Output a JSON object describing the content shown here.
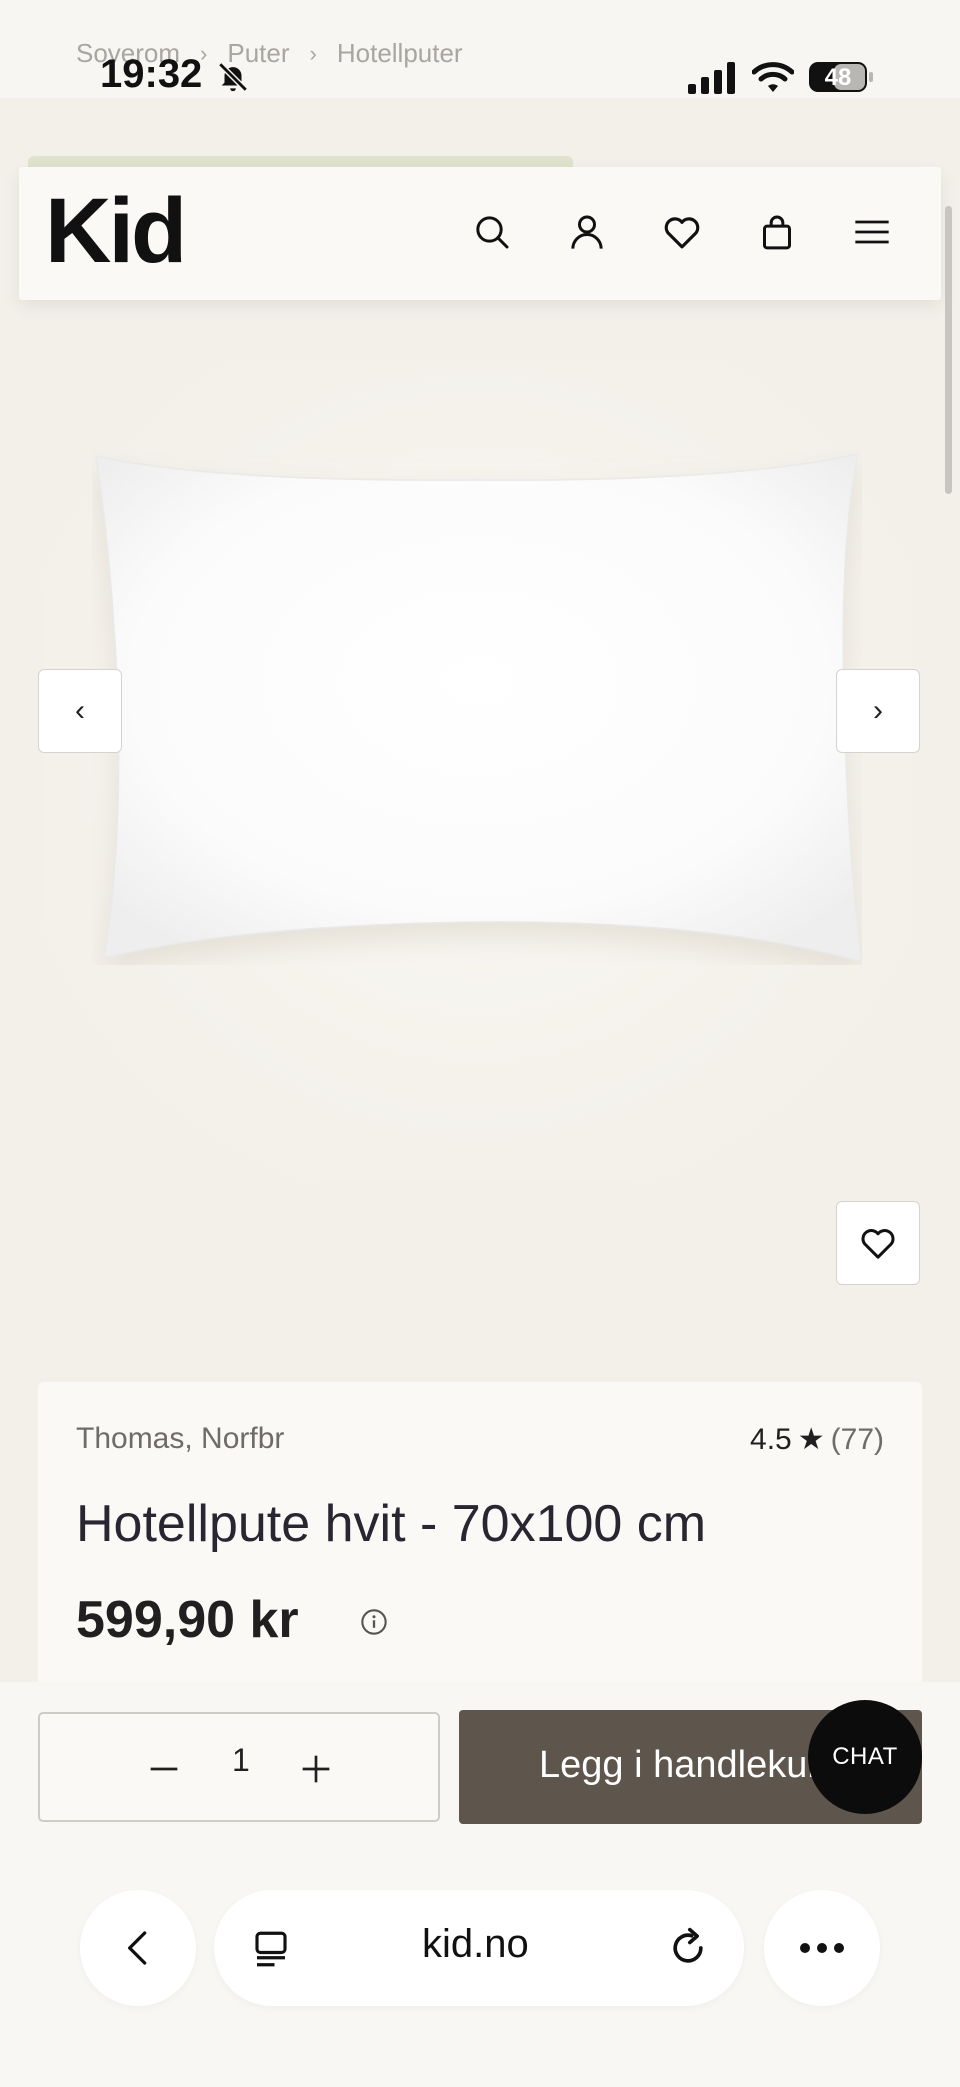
{
  "status_bar": {
    "time": "19:32",
    "battery_level": "48"
  },
  "breadcrumb": [
    "Soverom",
    "Puter",
    "Hotellputer"
  ],
  "header": {
    "logo": "Kid",
    "icons": [
      "search-icon",
      "user-icon",
      "heart-icon",
      "bag-icon",
      "menu-icon"
    ]
  },
  "gallery": {
    "prev_label": "‹",
    "next_label": "›"
  },
  "product": {
    "brand": "Thomas, Norfbr",
    "rating": "4.5",
    "rating_star": "★",
    "review_count": "(77)",
    "title": "Hotellpute hvit - 70x100 cm",
    "price": "599,90 kr"
  },
  "purchase": {
    "quantity": "1",
    "add_to_cart_label": "Legg i handlekurv",
    "chat_label": "CHAT"
  },
  "browser": {
    "url": "kid.no"
  },
  "colors": {
    "page_bg": "#f3f0ea",
    "cart_button": "#5e554d",
    "chat_bubble": "#0c0c0c"
  }
}
